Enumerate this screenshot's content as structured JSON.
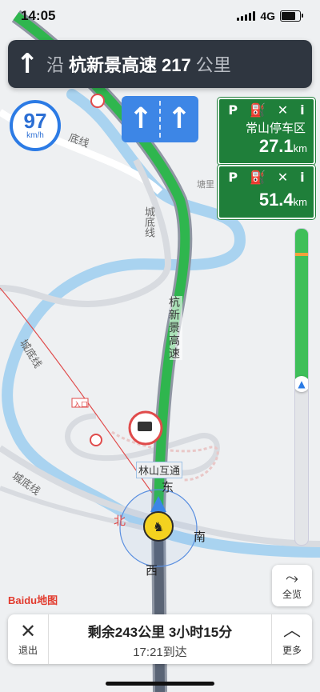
{
  "status_bar": {
    "time": "14:05",
    "network": "4G"
  },
  "guidance": {
    "prefix": "沿",
    "road": "杭新景高速",
    "distance": "217",
    "unit": "公里"
  },
  "speed": {
    "value": "97",
    "unit": "km/h"
  },
  "service_areas": [
    {
      "icons": [
        "P",
        "⛽",
        "✕",
        "i"
      ],
      "name": "常山停车区",
      "distance": "27.1",
      "unit": "km"
    },
    {
      "icons": [
        "P",
        "⛽",
        "✕",
        "i"
      ],
      "name": "",
      "distance": "51.4",
      "unit": "km"
    }
  ],
  "map_labels": {
    "road_vertical": "杭新景高速",
    "interchange": "林山互通",
    "chengdi_1": "底线",
    "chengdi_2": "城底线",
    "chengdi_3": "城底线",
    "chengdi_4": "城底线",
    "place": "塘里",
    "entrance": "入口",
    "compass_n": "北",
    "compass_e": "东",
    "compass_s": "南",
    "compass_w": "西"
  },
  "route_progress": {
    "completed_fraction": 0.49
  },
  "overview_button": {
    "label": "全览"
  },
  "logo": {
    "text": "Baidu地图"
  },
  "bottom_panel": {
    "exit_label": "退出",
    "remaining": "剩余243公里 3小时15分",
    "arrival": "17:21到达",
    "more_label": "更多"
  }
}
